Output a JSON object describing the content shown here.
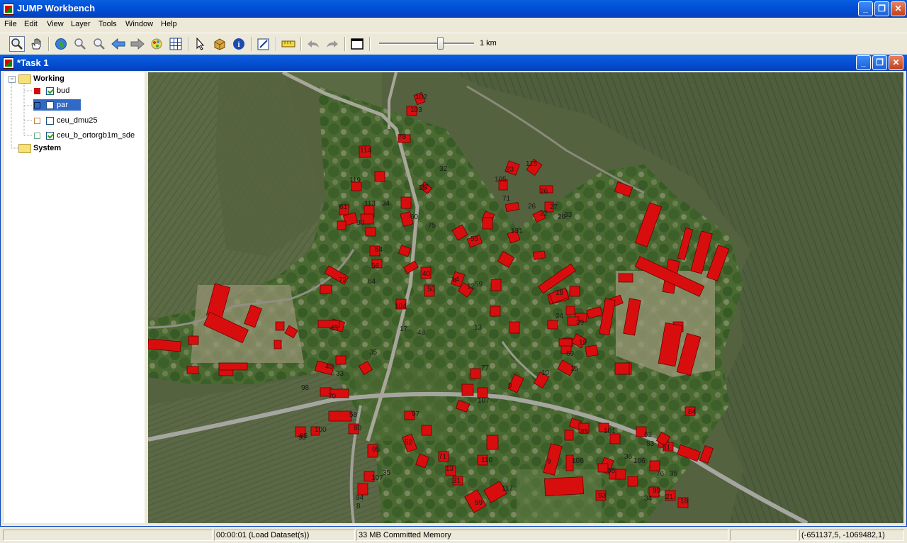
{
  "app": {
    "title": "JUMP Workbench"
  },
  "menu": [
    "File",
    "Edit",
    "View",
    "Layer",
    "Tools",
    "Window",
    "Help"
  ],
  "toolbar": {
    "icons": [
      "zoom-icon",
      "pan-icon",
      "zoom-to-full-extent-icon",
      "zoom-in-icon",
      "zoom-out-icon",
      "previous-view-icon",
      "next-view-icon",
      "zoom-to-layer-icon",
      "grid-icon",
      "select-icon",
      "fence-icon",
      "info-icon",
      "edit-toolbox-icon",
      "measure-icon",
      "undo-icon",
      "redo-icon",
      "frame-icon"
    ],
    "scale_label": "1 km",
    "zoom_slider_fraction": 0.65
  },
  "internal_frame": {
    "title": "*Task 1"
  },
  "layer_tree": {
    "categories": [
      {
        "name": "Working",
        "layers": [
          {
            "name": "bud",
            "checked": true,
            "symbol_color": "#cc1111",
            "selected": false
          },
          {
            "name": "par",
            "checked": false,
            "symbol_color": "#224477",
            "selected": true
          },
          {
            "name": "ceu_dmu25",
            "checked": false,
            "symbol_color": "#c08040",
            "selected": false
          },
          {
            "name": "ceu_b_ortorgb1m_sde",
            "checked": true,
            "symbol_color": "#66aa88",
            "selected": false
          }
        ]
      },
      {
        "name": "System",
        "layers": []
      }
    ]
  },
  "map": {
    "building_color": "#d80e0e",
    "labels": [
      "102",
      "103",
      "78",
      "114",
      "119",
      "61",
      "113",
      "30",
      "34",
      "37",
      "60",
      "75",
      "25",
      "32",
      "105",
      "71",
      "23",
      "131",
      "115",
      "26",
      "22",
      "20",
      "26",
      "27",
      "33",
      "55",
      "54",
      "56",
      "64",
      "40",
      "4",
      "72",
      "104",
      "50",
      "14",
      "12",
      "59",
      "18",
      "24",
      "39",
      "17",
      "48",
      "13",
      "43",
      "9",
      "49",
      "35",
      "33",
      "70",
      "58",
      "80",
      "100",
      "95",
      "98",
      "77",
      "107",
      "10",
      "15",
      "69",
      "19",
      "97",
      "65",
      "52",
      "71",
      "13",
      "31",
      "95",
      "35",
      "107",
      "110",
      "117",
      "99",
      "94",
      "8",
      "9",
      "108",
      "101",
      "62",
      "84",
      "36",
      "96",
      "34",
      "76",
      "83",
      "85",
      "106",
      "35",
      "90",
      "21",
      "51",
      "93",
      "18"
    ]
  },
  "status": {
    "timer": "00:00:01 (Load Dataset(s))",
    "memory": "33 MB Committed Memory",
    "coords": "(-651137,5, -1069482,1)"
  },
  "colors": {
    "titlebar": "#0050d8",
    "selection": "#316ac5",
    "buildings": "#d80e0e"
  }
}
